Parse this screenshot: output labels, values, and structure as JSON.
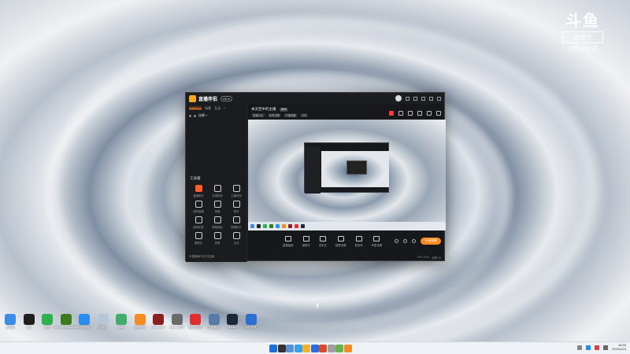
{
  "watermark": {
    "logo": "斗鱼",
    "line1": "直播号",
    "line2": "刘炸·好好说"
  },
  "app": {
    "name": "直播伴侣",
    "badge": "HD ▾",
    "sidebar": {
      "tabs": [
        "直播画面",
        "场景",
        "互动",
        "+"
      ],
      "scene_label": "场景一",
      "tools_title": "工具箱",
      "tools": [
        "直播助手",
        "礼物特效",
        "主播任务",
        "我的直播",
        "录播",
        "更多",
        "虚拟形象",
        "屏幕投影",
        "数据统计",
        "摄像头",
        "录屏",
        "互动"
      ],
      "footer": "本直播间今日已结束"
    },
    "main": {
      "room_title": "本天空中的主播",
      "room_badge": "编辑",
      "tags": [
        "直播分区",
        "标签设置",
        "开播提醒",
        "分享"
      ],
      "controls": [
        "直播画面",
        "摄像头",
        "多机位",
        "投屏设置",
        "麦克风",
        "声音设置"
      ],
      "live_button": "开始直播",
      "status": [
        "CPU 10%",
        "帧率 30"
      ]
    }
  },
  "desktop_icons": [
    {
      "label": "此电脑",
      "color": "#3d8be8"
    },
    {
      "label": "QQ",
      "color": "#1f1f1f"
    },
    {
      "label": "微信",
      "color": "#2bb24c"
    },
    {
      "label": "GeForce Experience",
      "color": "#3b7b1d"
    },
    {
      "label": "百度网盘",
      "color": "#2a8df0"
    },
    {
      "label": "回收站",
      "color": "#b7c6d6"
    },
    {
      "label": "Edge",
      "color": "#3fae6a"
    },
    {
      "label": "直播伴侣",
      "color": "#f58c23"
    },
    {
      "label": "StarCraft II",
      "color": "#8b1f1f"
    },
    {
      "label": "Steam 游戏",
      "color": "#6a6a6a"
    },
    {
      "label": "网易云音乐",
      "color": "#e02d2d"
    },
    {
      "label": "百度翻译",
      "color": "#5a7aa8"
    },
    {
      "label": "Steam",
      "color": "#1b2838"
    },
    {
      "label": "网络加速",
      "color": "#2d6fd0"
    }
  ],
  "taskbar": {
    "icons": [
      "#1f6fd6",
      "#333333",
      "#5b8fd6",
      "#3aa0e8",
      "#f0b430",
      "#2b6be0",
      "#d84a2a",
      "#a0a0a0",
      "#6ab04c",
      "#f58c23"
    ],
    "time": "16:50",
    "date": "2023/4/24"
  }
}
